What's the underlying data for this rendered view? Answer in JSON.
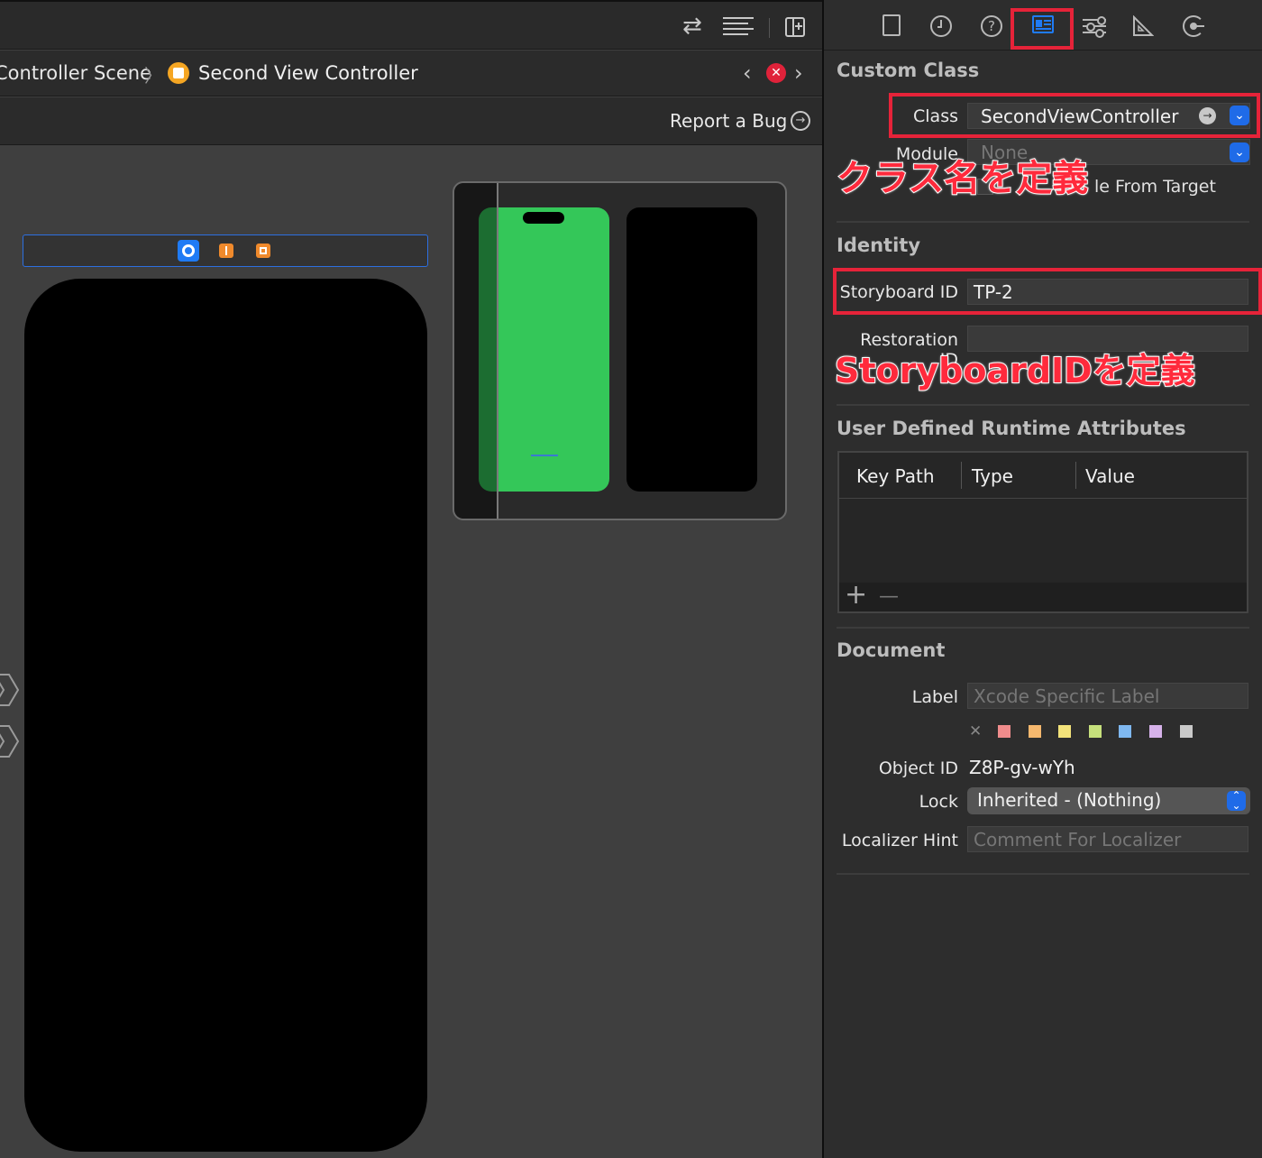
{
  "editor": {
    "breadcrumb": {
      "scene": "Controller Scene",
      "controller": "Second View Controller"
    },
    "report_bug": "Report a Bug"
  },
  "inspector": {
    "custom_class": {
      "title": "Custom Class",
      "class_label": "Class",
      "class_value": "SecondViewController",
      "module_label": "Module",
      "module_value": "None",
      "inherit_text": "Inherit Module From Target",
      "inherit_visible": "le From Target"
    },
    "identity": {
      "title": "Identity",
      "storyboard_label": "Storyboard ID",
      "storyboard_value": "TP-2",
      "restoration_label": "Restoration ID"
    },
    "runtime": {
      "title": "User Defined Runtime Attributes",
      "columns": [
        "Key Path",
        "Type",
        "Value"
      ],
      "add": "+",
      "remove": "—"
    },
    "document": {
      "title": "Document",
      "label_label": "Label",
      "label_placeholder": "Xcode Specific Label",
      "swatch_colors": [
        "#f08c8c",
        "#f5b86e",
        "#f3e27a",
        "#c6e07c",
        "#7fb8f0",
        "#d6b2ea",
        "#c9c9c9"
      ],
      "clear": "✕",
      "object_id_label": "Object ID",
      "object_id_value": "Z8P-gv-wYh",
      "lock_label": "Lock",
      "lock_value": "Inherited - (Nothing)",
      "hint_label": "Localizer Hint",
      "hint_placeholder": "Comment For Localizer"
    }
  },
  "annotations": {
    "class_note": "クラス名を定義",
    "storyboard_note": "StoryboardIDを定義"
  },
  "colors": {
    "accent": "#1f6be8",
    "annotation_red": "#e62339",
    "preview_green": "#34c759"
  }
}
